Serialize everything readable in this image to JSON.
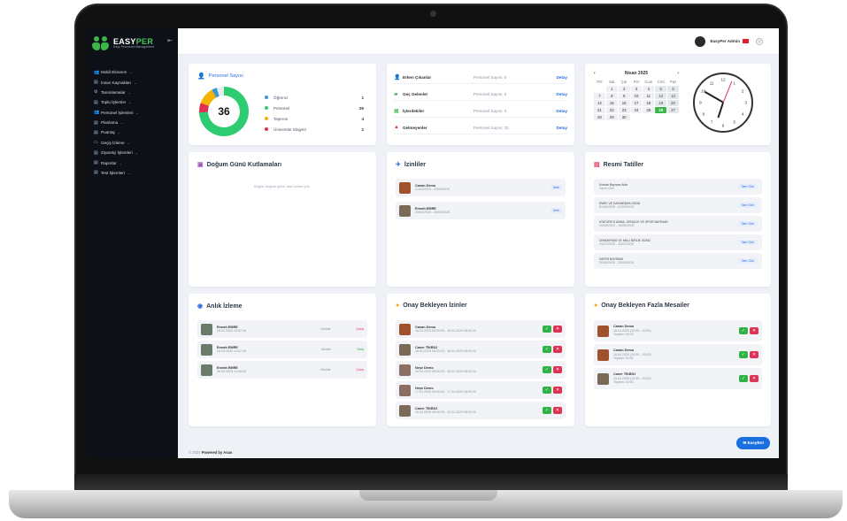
{
  "app": {
    "brand_prefix": "EASY",
    "brand_suffix": "PER",
    "brand_tagline": "Easy Personnel Management",
    "user_name": "EasyPer Admin"
  },
  "sidebar": {
    "items": [
      {
        "label": "Mobil Ekranım",
        "icon": "users-icon"
      },
      {
        "label": "İnsan Kaynakları",
        "icon": "file-icon"
      },
      {
        "label": "Tanımlamalar",
        "icon": "settings-icon"
      },
      {
        "label": "Toplu İşlemler",
        "icon": "file-icon"
      },
      {
        "label": "Personel İşlemleri",
        "icon": "users-icon"
      },
      {
        "label": "Planlama",
        "icon": "file-icon"
      },
      {
        "label": "Puantaj",
        "icon": "file-icon"
      },
      {
        "label": "Geçiş İzleme",
        "icon": "monitor-icon"
      },
      {
        "label": "Ziyaretçi İşlemleri",
        "icon": "file-icon"
      },
      {
        "label": "Raporlar",
        "icon": "file-icon"
      },
      {
        "label": "Test İşlemleri",
        "icon": "file-icon"
      }
    ]
  },
  "personnel": {
    "title": "Personel Sayısı",
    "total": "36",
    "legend": [
      {
        "label": "Öğrenci",
        "value": "1",
        "color": "#3498db"
      },
      {
        "label": "Personel",
        "value": "29",
        "color": "#2ecc71"
      },
      {
        "label": "Taşeron",
        "value": "4",
        "color": "#f5b301"
      },
      {
        "label": "Üniversite Stajyeri",
        "value": "2",
        "color": "#e03155"
      }
    ]
  },
  "status": {
    "rows": [
      {
        "label": "Erken Çıkanlar",
        "count": "Personel Sayısı: 0",
        "detail": "Detay",
        "icon": "user-icon",
        "color": "#2d6cdf"
      },
      {
        "label": "Geç Gelenler",
        "count": "Personel Sayısı: 0",
        "detail": "Detay",
        "icon": "car-icon",
        "color": "#2fb344"
      },
      {
        "label": "İşlerdekiler",
        "count": "Personel Sayısı: 3",
        "detail": "Detay",
        "icon": "building-icon",
        "color": "#2fb344"
      },
      {
        "label": "Gelmeyenler",
        "count": "Personel Sayısı: 32",
        "detail": "Detay",
        "icon": "warning-icon",
        "color": "#e03155"
      }
    ]
  },
  "calendar": {
    "month": "Nisan 2025",
    "prev": "‹",
    "next": "›",
    "day_names": [
      "Pzt",
      "Sal",
      "Çar",
      "Per",
      "Cum",
      "Cmt",
      "Paz"
    ],
    "leading_blanks": 1,
    "days": [
      "1",
      "2",
      "3",
      "4",
      "5",
      "6",
      "7",
      "8",
      "9",
      "10",
      "11",
      "12",
      "13",
      "14",
      "15",
      "16",
      "17",
      "18",
      "19",
      "20",
      "21",
      "22",
      "23",
      "24",
      "25",
      "26",
      "27",
      "28",
      "29",
      "30"
    ],
    "today": "26"
  },
  "birthdays": {
    "title": "Doğum Günü Kutlamaları",
    "empty": "Bugün doğum günü olan kimse yok."
  },
  "leaves": {
    "title": "İzinliler",
    "items": [
      {
        "name": "Canan Demo",
        "date": "21/04/2025 - 29/04/2025",
        "badge": "İzinli"
      },
      {
        "name": "Emrah EMRE",
        "date": "25/04/2025 - 28/04/2025",
        "badge": "İzinli"
      }
    ]
  },
  "holidays": {
    "title": "Resmi Tatiller",
    "badge": "Tam Gün",
    "items": [
      {
        "name": "Kurban Bayramı Arife",
        "date": "Yarım Gün"
      },
      {
        "name": "EMEK VE DAYANIŞMA GÜNÜ",
        "date": "01/05/2025 - 01/05/2025"
      },
      {
        "name": "ATATÜRK'Ü ANMA, GENÇLİK VE SPOR BAYRAMI",
        "date": "19/05/2025 - 19/05/2025"
      },
      {
        "name": "DEMOKRASİ VE MİLLİ BİRLİK GÜNÜ",
        "date": "15/07/2025 - 15/07/2025"
      },
      {
        "name": "ZAFER BAYRAMI",
        "date": "30/08/2025 - 30/08/2025"
      }
    ]
  },
  "live": {
    "title": "Anlık İzleme",
    "items": [
      {
        "name": "Emrah EMRE",
        "time": "26.04.2025 14:57:16",
        "device": "Mobile",
        "dir": "Çıkış"
      },
      {
        "name": "Emrah EMRE",
        "time": "26.04.2025 14:57:08",
        "device": "Mobile",
        "dir": "Giriş"
      },
      {
        "name": "Emrah EMRE",
        "time": "26.04.2025 14:56:53",
        "device": "Mobile",
        "dir": "Çıkış"
      }
    ]
  },
  "pending_leaves": {
    "title": "Onay Bekleyen İzinler",
    "items": [
      {
        "name": "Canan Demo",
        "date": "16.04.2025 08:00:00 - 16.04.2025 08:00:00"
      },
      {
        "name": "Caner TİKBİLİ",
        "date": "16.04.2025 08:00:00 - 16.04.2025 08:00:00"
      },
      {
        "name": "Neşe Demo",
        "date": "16.04.2025 08:00:00 - 16.04.2025 08:00:00"
      },
      {
        "name": "Neşe Demo",
        "date": "17.04.2025 08:00:00 - 17.04.2025 08:00:00"
      },
      {
        "name": "Caner TİKBİLİ",
        "date": "15.04.2025 08:00:00 - 15.04.2025 08:00:00"
      }
    ]
  },
  "pending_overtime": {
    "title": "Onay Bekleyen Fazla Mesailer",
    "items": [
      {
        "name": "Canan Demo",
        "date": "15.04.2025 (19:00 - 20:00)",
        "sub": "Toplam: 02:00"
      },
      {
        "name": "Canan Demo",
        "date": "16.04.2025 (19:00 - 20:00)",
        "sub": "Toplam: 02:00"
      },
      {
        "name": "Caner TİKBİLİ",
        "date": "15.04.2025 (19:00 - 20:00)",
        "sub": "Toplam: 02:00"
      }
    ]
  },
  "footer": {
    "copyright": "© 2024",
    "powered": "Powered by Asas"
  },
  "fab": {
    "label": "EasyBot"
  },
  "colors": {
    "brand_green": "#3cb64a",
    "accent_blue": "#1a6fe0",
    "danger": "#e03155",
    "success": "#2fb344"
  }
}
